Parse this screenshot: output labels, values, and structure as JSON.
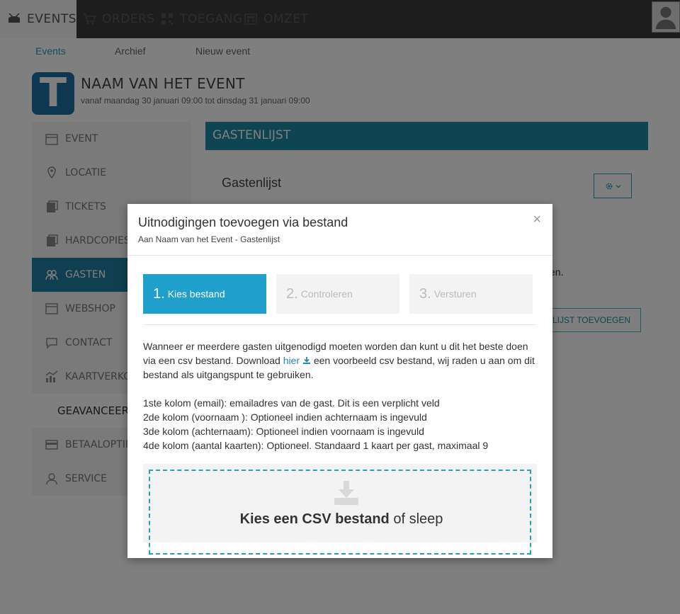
{
  "topnav": {
    "tabs": [
      {
        "label": "EVENTS",
        "icon": "drum-icon"
      },
      {
        "label": "ORDERS",
        "icon": "cart-icon"
      },
      {
        "label": "TOEGANG",
        "icon": "qr-icon"
      },
      {
        "label": "OMZET",
        "icon": "register-icon"
      }
    ]
  },
  "subnav": [
    "Events",
    "Archief",
    "Nieuw event"
  ],
  "event": {
    "logo_letter": "T",
    "title": "NAAM VAN HET EVENT",
    "date": "vanaf maandag 30 januari 09:00 tot dinsdag 31 januari 09:00"
  },
  "sidemenu": {
    "items": [
      {
        "label": "EVENT",
        "icon": "calendar-icon"
      },
      {
        "label": "LOCATIE",
        "icon": "map-pin-icon"
      },
      {
        "label": "TICKETS",
        "icon": "tickets-icon"
      },
      {
        "label": "HARDCOPIES",
        "icon": "hardcopies-icon"
      },
      {
        "label": "GASTEN",
        "icon": "guests-icon"
      },
      {
        "label": "WEBSHOP",
        "icon": "webshop-icon"
      },
      {
        "label": "CONTACT",
        "icon": "chat-icon"
      },
      {
        "label": "KAARTVERKOOP",
        "icon": "chart-icon"
      }
    ],
    "section_label": "GEAVANCEERDE",
    "extra_items": [
      {
        "label": "BETAALOPTIES",
        "icon": "credit-card-icon"
      },
      {
        "label": "SERVICE",
        "icon": "support-icon"
      }
    ]
  },
  "panel": {
    "header": "GASTENLIJST",
    "subtitle": "Gastenlijst",
    "text_tail": "en.",
    "add_button": "LIJST TOEVOEGEN"
  },
  "modal": {
    "title": "Uitnodigingen toevoegen via bestand",
    "subtitle": "Aan Naam van het Event - Gastenlijst",
    "close": "×",
    "steps": [
      {
        "num": "1.",
        "label": "Kies bestand"
      },
      {
        "num": "2.",
        "label": "Controleren"
      },
      {
        "num": "3.",
        "label": "Versturen"
      }
    ],
    "desc_before": "Wanneer er meerdere gasten uitgenodigd moeten worden dan kunt u dit het beste doen via een csv bestand. Download",
    "desc_link": "hier",
    "desc_after": "een voorbeeld csv bestand, wij raden u aan om dit bestand als uitgangspunt te gebruiken.",
    "columns": [
      "1ste kolom (email): emailadres van de gast. Dit is een verplicht veld",
      "2de kolom (voornaam ): Optioneel indien achternaam is ingevuld",
      "3de kolom (achternaam): Optioneel indien voornaam is ingevuld",
      "4de kolom (aantal kaarten): Optioneel. Standaard 1 kaart per gast, maximaal 9"
    ],
    "dropzone_bold": "Kies een CSV bestand",
    "dropzone_rest": "of sleep"
  },
  "colors": {
    "accent": "#1e9fcc",
    "panel_header": "#1f8aa4",
    "active_menu": "#1f7fa0",
    "topnav": "#3a3a3a"
  }
}
